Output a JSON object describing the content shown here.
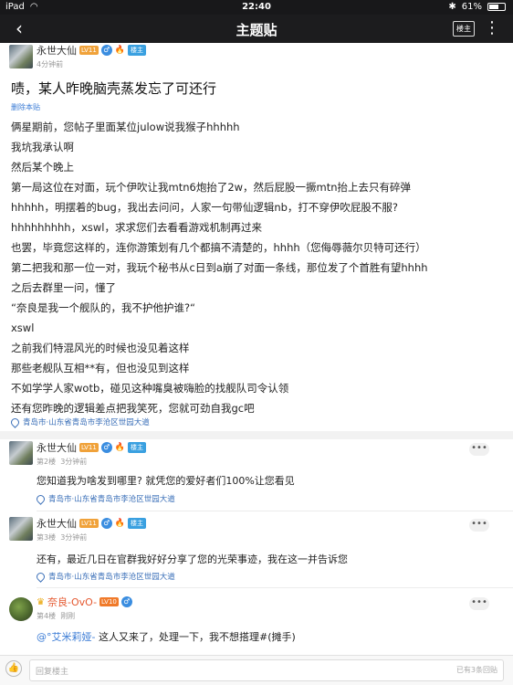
{
  "status": {
    "carrier": "iPad",
    "time": "22:40",
    "battery": "61%",
    "battery_level": 0.61
  },
  "nav": {
    "title": "主题贴",
    "op_badge": "楼主"
  },
  "post": {
    "author": "永世大仙",
    "level": "LV11",
    "gender_icon": "♂",
    "op_tag": "楼主",
    "time": "4分钟前",
    "title": "啧，某人昨晚脑壳蒸发忘了可还行",
    "delete": "删除本贴",
    "lines": [
      "俩星期前，您帖子里面某位julow说我猴子hhhhh",
      "我坑我承认啊",
      "然后某个晚上",
      "第一局这位在对面，玩个伊吹让我mtn6炮抬了2w，然后屁股一撅mtn抬上去只有碎弹",
      "hhhhh，明摆着的bug，我出去问问，人家一句带仙逻辑nb，打不穿伊吹屁股不服?",
      "hhhhhhhhh，xswl，求求您们去看看游戏机制再过来",
      "也罢，毕竟您这样的，连你游策划有几个都搞不清楚的，hhhh（您侮辱薇尔贝特可还行）",
      "第二把我和那一位一对，我玩个秘书从c日到a崩了对面一条线，那位发了个首胜有望hhhh",
      "之后去群里一问，懂了",
      "“奈良是我一个舰队的，我不护他护谁?“",
      "xswl",
      "之前我们特混风光的时候也没见着这样",
      "那些老舰队互相**有，但也没见到这样",
      "不如学学人家wotb，碰见这种嘴臭被嗨脸的找舰队司令认领",
      "还有您昨晚的逻辑差点把我笑死，您就可劲自我gc吧"
    ],
    "location": "青岛市·山东省青岛市李沧区世园大道"
  },
  "replies": [
    {
      "author": "永世大仙",
      "level": "LV11",
      "gender_icon": "♂",
      "op_tag": "楼主",
      "floor": "第2楼",
      "time": "3分钟前",
      "text": "您知道我为啥发到哪里? 就凭您的爱好者们100%让您看见",
      "location": "青岛市·山东省青岛市李沧区世园大道",
      "more": "•••"
    },
    {
      "author": "永世大仙",
      "level": "LV11",
      "gender_icon": "♂",
      "op_tag": "楼主",
      "floor": "第3楼",
      "time": "3分钟前",
      "text": "还有，最近几日在官群我好好分享了您的光荣事迹，我在这一并告诉您",
      "location": "青岛市·山东省青岛市李沧区世园大道",
      "more": "•••"
    },
    {
      "author": "奈良-OvO-",
      "level": "LV10",
      "gender_icon": "♂",
      "floor": "第4楼",
      "time": "刚刚",
      "mention": "@°艾米莉娅-",
      "text": " 这人又来了，处理一下，我不想搭理#(摊手)",
      "more": "•••"
    }
  ],
  "bottom": {
    "placeholder": "回复楼主",
    "count": "已有3条回贴"
  }
}
